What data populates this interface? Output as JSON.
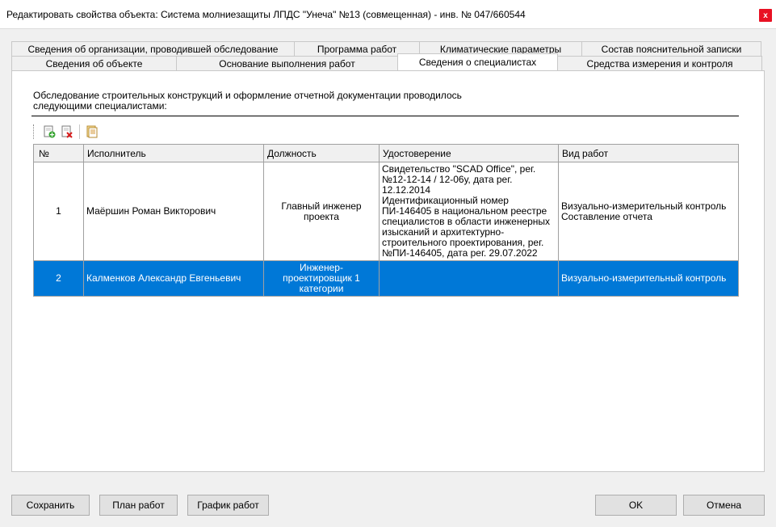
{
  "window": {
    "title": "Редактировать свойства объекта: Система молниезащиты ЛПДС \"Унеча\" №13 (совмещенная) - инв. № 047/660544",
    "close_glyph": "x"
  },
  "tabs_row1": [
    {
      "label": "Сведения об организации, проводившей обследование"
    },
    {
      "label": "Программа работ"
    },
    {
      "label": "Климатические параметры"
    },
    {
      "label": "Состав пояснительной записки"
    }
  ],
  "tabs_row2": [
    {
      "label": "Сведения об объекте"
    },
    {
      "label": "Основание выполнения работ"
    },
    {
      "label": "Сведения о специалистах",
      "active": true
    },
    {
      "label": "Средства измерения и контроля"
    }
  ],
  "panel": {
    "description": "Обследование строительных конструкций и оформление отчетной документации проводилось следующими специалистами:"
  },
  "toolbar": {
    "icons": [
      "add-row-icon",
      "delete-row-icon",
      "copy-document-icon"
    ]
  },
  "table": {
    "columns": [
      "№",
      "Исполнитель",
      "Должность",
      "Удостоверение",
      "Вид работ"
    ],
    "rows": [
      {
        "num": "1",
        "name": "Маёршин Роман Викторович",
        "position": "Главный инженер проекта",
        "certificate": "Свидетельство \"SCAD Office\", рег.№12-12-14 / 12-06у, дата рег. 12.12.2014\nИдентификационный номер ПИ-146405 в национальном реестре специалистов в области инженерных изысканий и архитектурно-строительного проектирования, рег.№ПИ-146405, дата рег. 29.07.2022",
        "work": "Визуально-измерительный контроль\nСоставление отчета"
      },
      {
        "num": "2",
        "name": "Калменков Александр Евгеньевич",
        "position": "Инженер-проектировщик 1 категории",
        "certificate": "",
        "work": "Визуально-измерительный контроль"
      }
    ]
  },
  "buttons": {
    "save": "Сохранить",
    "plan": "План работ",
    "schedule": "График работ",
    "ok": "OK",
    "cancel": "Отмена"
  }
}
